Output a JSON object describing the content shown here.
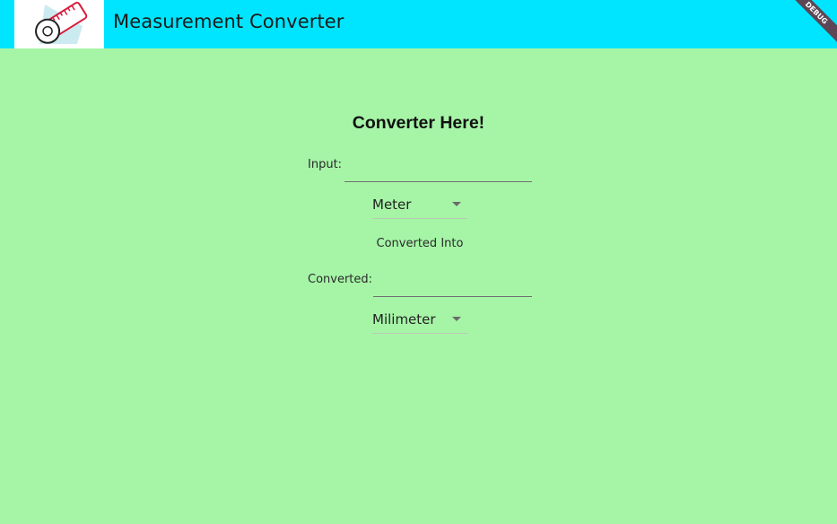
{
  "app_bar": {
    "title": "Measurement Converter",
    "logo_icon": "measuring-tape-icon",
    "background_color": "#00e5ff",
    "debug_banner": "DEBUG"
  },
  "main": {
    "background_color": "#a6f5a7",
    "heading": "Converter Here!",
    "input": {
      "label": "Input:",
      "value": ""
    },
    "from_unit": {
      "selected": "Meter"
    },
    "converted_into_text": "Converted Into",
    "output": {
      "label": "Converted:",
      "value": ""
    },
    "to_unit": {
      "selected": "Milimeter"
    }
  }
}
